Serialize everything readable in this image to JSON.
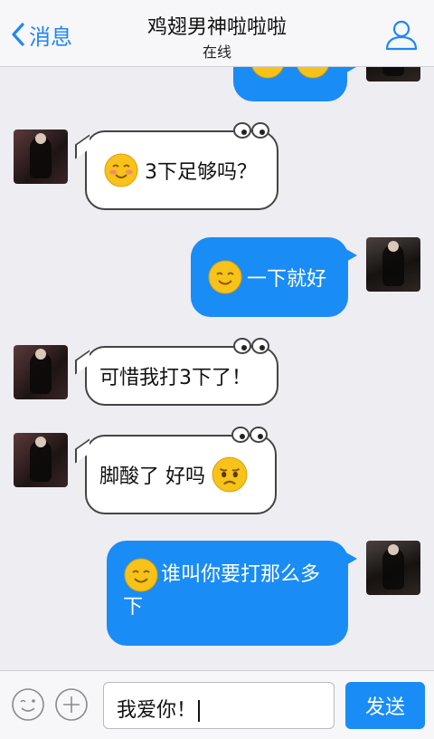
{
  "header": {
    "back_label": "消息",
    "title": "鸡翅男神啦啦啦",
    "status": "在线"
  },
  "messages": [
    {
      "side": "out",
      "text": ""
    },
    {
      "side": "in",
      "text": "3下足够吗？"
    },
    {
      "side": "out",
      "text": "一下就好"
    },
    {
      "side": "in",
      "text": "可惜我打3下了！"
    },
    {
      "side": "in",
      "text": "脚酸了 好吗"
    },
    {
      "side": "out",
      "text": "谁叫你要打那么多下"
    }
  ],
  "input": {
    "value": "我爱你！",
    "send_label": "发送"
  },
  "colors": {
    "accent": "#1a8cf5",
    "background": "#ededf2",
    "emoji": "#f7c21a"
  }
}
